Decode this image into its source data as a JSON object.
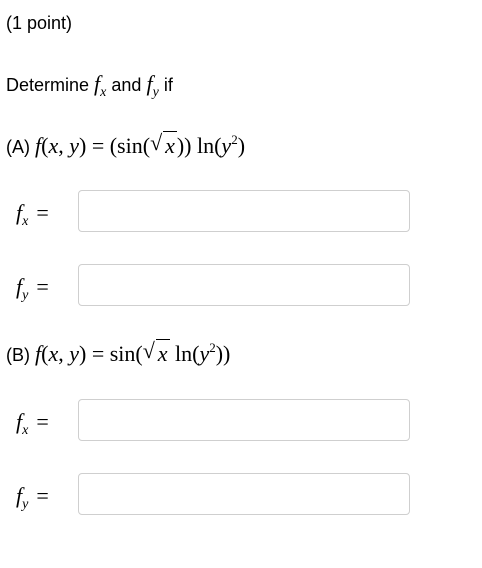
{
  "points": "(1 point)",
  "instruction": {
    "prefix": "Determine",
    "mid": "and",
    "suffix": "if"
  },
  "part_a": {
    "label": "(A)"
  },
  "part_b": {
    "label": "(B)"
  },
  "fields": {
    "a_fx": {
      "value": ""
    },
    "a_fy": {
      "value": ""
    },
    "b_fx": {
      "value": ""
    },
    "b_fy": {
      "value": ""
    }
  }
}
